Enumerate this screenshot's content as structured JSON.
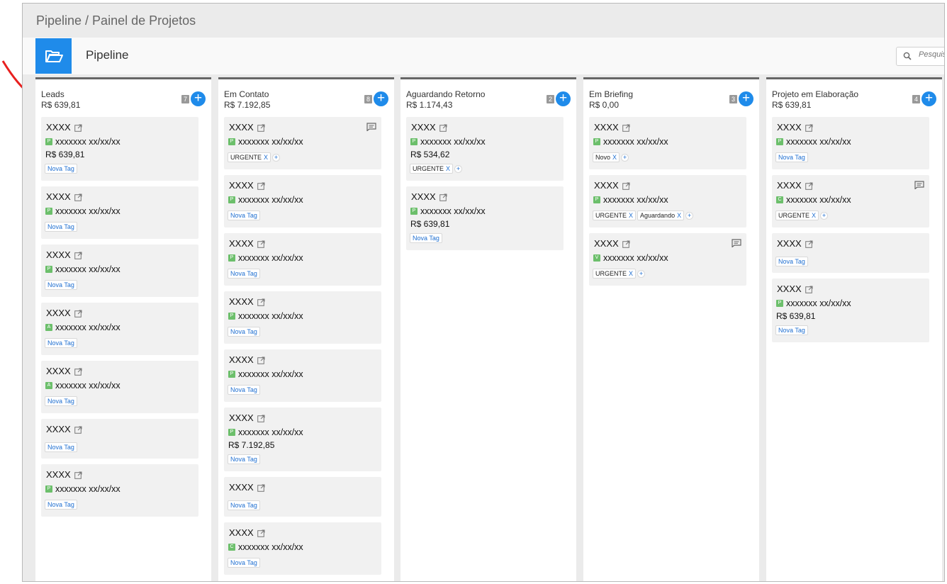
{
  "breadcrumb": "Pipeline / Painel de Projetos",
  "toolbar": {
    "title": "Pipeline",
    "folder_icon": "folder-open-icon",
    "accent": "#1f8bea"
  },
  "search": {
    "placeholder": "Pesquisar"
  },
  "annotation": {
    "arrow_color": "#e8201f"
  },
  "columns": [
    {
      "title": "Leads",
      "total": "R$ 639,81",
      "count": "7",
      "cards": [
        {
          "name": "XXXX",
          "badge": "P",
          "line": "xxxxxxx  xx/xx/xx",
          "value": "R$ 639,81",
          "tags": [],
          "show_nova": true,
          "comment": false
        },
        {
          "name": "XXXX",
          "badge": "P",
          "line": "xxxxxxx  xx/xx/xx",
          "value": "",
          "tags": [],
          "show_nova": true,
          "comment": false
        },
        {
          "name": "XXXX",
          "badge": "P",
          "line": "xxxxxxx  xx/xx/xx",
          "value": "",
          "tags": [],
          "show_nova": true,
          "comment": false
        },
        {
          "name": "XXXX",
          "badge": "A",
          "line": "xxxxxxx  xx/xx/xx",
          "value": "",
          "tags": [],
          "show_nova": true,
          "comment": false
        },
        {
          "name": "XXXX",
          "badge": "A",
          "line": "xxxxxxx  xx/xx/xx",
          "value": "",
          "tags": [],
          "show_nova": true,
          "comment": false
        },
        {
          "name": "XXXX",
          "badge": "",
          "line": "",
          "value": "",
          "tags": [],
          "show_nova": true,
          "comment": false
        },
        {
          "name": "XXXX",
          "badge": "P",
          "line": "xxxxxxx  xx/xx/xx",
          "value": "",
          "tags": [],
          "show_nova": true,
          "comment": false
        }
      ]
    },
    {
      "title": "Em Contato",
      "total": "R$ 7.192,85",
      "count": "8",
      "cards": [
        {
          "name": "XXXX",
          "badge": "P",
          "line": "xxxxxxx  xx/xx/xx",
          "value": "",
          "tags": [
            "URGENTE"
          ],
          "show_nova": false,
          "comment": true
        },
        {
          "name": "XXXX",
          "badge": "P",
          "line": "xxxxxxx  xx/xx/xx",
          "value": "",
          "tags": [],
          "show_nova": true,
          "comment": false
        },
        {
          "name": "XXXX",
          "badge": "P",
          "line": "xxxxxxx  xx/xx/xx",
          "value": "",
          "tags": [],
          "show_nova": true,
          "comment": false
        },
        {
          "name": "XXXX",
          "badge": "P",
          "line": "xxxxxxx  xx/xx/xx",
          "value": "",
          "tags": [],
          "show_nova": true,
          "comment": false
        },
        {
          "name": "XXXX",
          "badge": "P",
          "line": "xxxxxxx  xx/xx/xx",
          "value": "",
          "tags": [],
          "show_nova": true,
          "comment": false
        },
        {
          "name": "XXXX",
          "badge": "P",
          "line": "xxxxxxx  xx/xx/xx",
          "value": "R$ 7.192,85",
          "tags": [],
          "show_nova": true,
          "comment": false
        },
        {
          "name": "XXXX",
          "badge": "",
          "line": "",
          "value": "",
          "tags": [],
          "show_nova": true,
          "comment": false
        },
        {
          "name": "XXXX",
          "badge": "C",
          "line": "xxxxxxx  xx/xx/xx",
          "value": "",
          "tags": [],
          "show_nova": true,
          "comment": false
        }
      ]
    },
    {
      "title": "Aguardando Retorno",
      "total": "R$ 1.174,43",
      "count": "2",
      "cards": [
        {
          "name": "XXXX",
          "badge": "P",
          "line": "xxxxxxx  xx/xx/xx",
          "value": "R$ 534,62",
          "tags": [
            "URGENTE"
          ],
          "show_nova": false,
          "comment": false
        },
        {
          "name": "XXXX",
          "badge": "P",
          "line": "xxxxxxx  xx/xx/xx",
          "value": "R$ 639,81",
          "tags": [],
          "show_nova": true,
          "comment": false
        }
      ]
    },
    {
      "title": "Em Briefing",
      "total": "R$ 0,00",
      "count": "3",
      "cards": [
        {
          "name": "XXXX",
          "badge": "P",
          "line": "xxxxxxx  xx/xx/xx",
          "value": "",
          "tags": [
            "Novo"
          ],
          "show_nova": false,
          "comment": false
        },
        {
          "name": "XXXX",
          "badge": "P",
          "line": "xxxxxxx  xx/xx/xx",
          "value": "",
          "tags": [
            "URGENTE",
            "Aguardando"
          ],
          "show_nova": false,
          "comment": false
        },
        {
          "name": "XXXX",
          "badge": "V",
          "line": "xxxxxxx  xx/xx/xx",
          "value": "",
          "tags": [
            "URGENTE"
          ],
          "show_nova": false,
          "comment": true
        }
      ]
    },
    {
      "title": "Projeto em Elaboração",
      "total": "R$ 639,81",
      "count": "4",
      "cards": [
        {
          "name": "XXXX",
          "badge": "P",
          "line": "xxxxxxx  xx/xx/xx",
          "value": "",
          "tags": [],
          "show_nova": true,
          "comment": false
        },
        {
          "name": "XXXX",
          "badge": "C",
          "line": "xxxxxxx  xx/xx/xx",
          "value": "",
          "tags": [
            "URGENTE"
          ],
          "show_nova": false,
          "comment": true
        },
        {
          "name": "XXXX",
          "badge": "",
          "line": "",
          "value": "",
          "tags": [],
          "show_nova": true,
          "comment": false
        },
        {
          "name": "XXXX",
          "badge": "P",
          "line": "xxxxxxx  xx/xx/xx",
          "value": "R$ 639,81",
          "tags": [],
          "show_nova": true,
          "comment": false
        }
      ]
    }
  ],
  "labels": {
    "nova_tag": "Nova Tag",
    "tag_remove": "X",
    "tag_add": "+",
    "column_add": "+"
  }
}
